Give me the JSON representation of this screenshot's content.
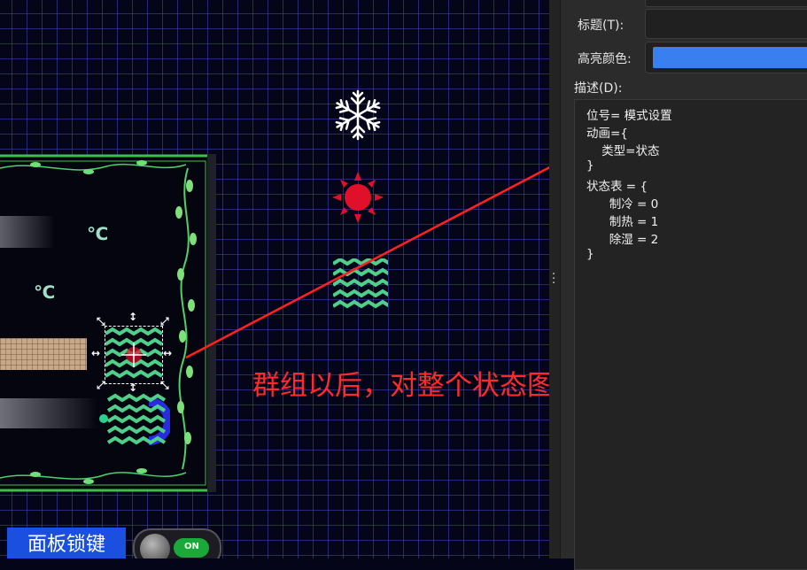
{
  "canvas": {
    "temp_unit_1": "℃",
    "temp_unit_2": "℃",
    "annotation": "群组以后，对整个状态图进行拓扑配置",
    "lock_button_label": "面板锁键",
    "toggle_label": "ON",
    "icons": [
      "snowflake-icon",
      "sun-icon",
      "wave-dehumidify-icon"
    ]
  },
  "properties": {
    "title_label": "标题(T):",
    "title_value": "",
    "highlight_color_label": "高亮颜色:",
    "highlight_color": "#3a7ff0",
    "description_label": "描述(D):",
    "description_lines": [
      "位号= 模式设置",
      "动画={",
      "    类型=状态",
      "}",
      "状态表 = {",
      "      制冷 = 0",
      "      制热 = 1",
      "      除湿 = 2",
      "}"
    ]
  },
  "colors": {
    "annotation": "#ff2a2a",
    "arrow": "#ff2020",
    "lock_button": "#1a4fe0",
    "wave": "#4fd08a",
    "sun": "#e0102a",
    "frame_green": "#3fbf4a"
  }
}
